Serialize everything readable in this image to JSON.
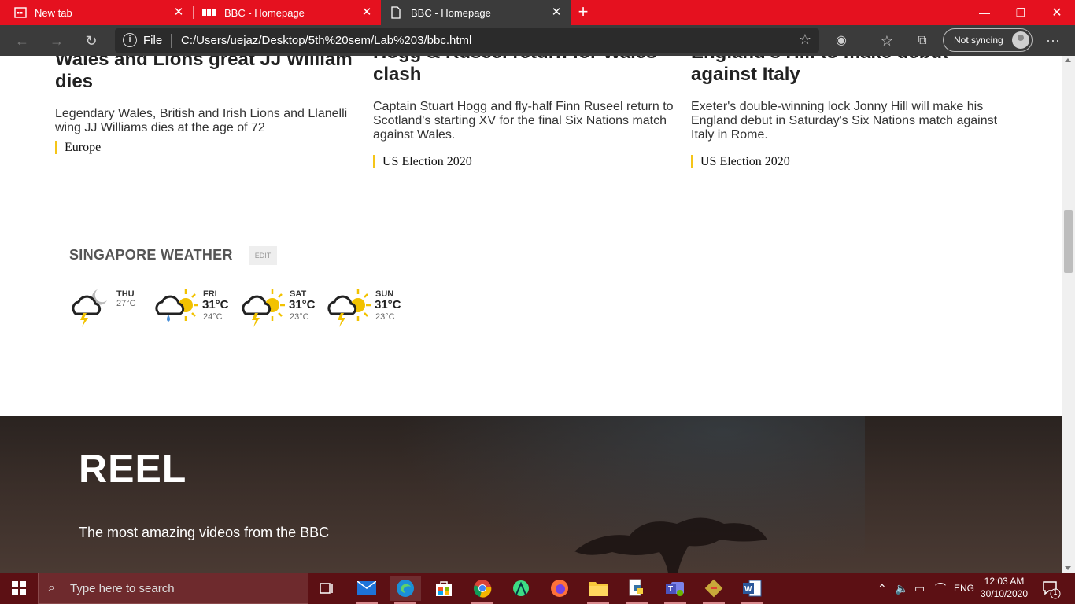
{
  "browser": {
    "tabs": [
      {
        "title": "New tab",
        "icon": "newtab-icon"
      },
      {
        "title": "BBC - Homepage",
        "icon": "bbc-icon"
      },
      {
        "title": "BBC - Homepage",
        "icon": "page-icon"
      }
    ],
    "address": {
      "scheme_label": "File",
      "url": "C:/Users/uejaz/Desktop/5th%20sem/Lab%203/bbc.html"
    },
    "profile_label": "Not syncing",
    "accent_color": "#e5111f"
  },
  "stories": [
    {
      "title": "Wales and Lions great JJ William dies",
      "summary": "Legendary Wales, British and Irish Lions and Llanelli wing JJ Williams dies at the age of 72",
      "tag": "Europe"
    },
    {
      "title": "Hogg & Ruseel return for Wales clash",
      "summary": "Captain Stuart Hogg and fly-half Finn Ruseel return to Scotland's starting XV for the final Six Nations match against Wales.",
      "tag": "US Election 2020"
    },
    {
      "title": "England's Hill to make debut against Italy",
      "summary": "Exeter's double-winning lock Jonny Hill will make his England debut in Saturday's Six Nations match against Italy in Rome.",
      "tag": "US Election 2020"
    }
  ],
  "weather": {
    "title": "SINGAPORE WEATHER",
    "edit_label": "EDIT",
    "days": [
      {
        "day": "THU",
        "high": "",
        "low": "27°C",
        "icon": "thunder-night-icon"
      },
      {
        "day": "FRI",
        "high": "31°C",
        "low": "24°C",
        "icon": "sun-rain-icon"
      },
      {
        "day": "SAT",
        "high": "31°C",
        "low": "23°C",
        "icon": "sun-thunder-icon"
      },
      {
        "day": "SUN",
        "high": "31°C",
        "low": "23°C",
        "icon": "sun-thunder-icon"
      }
    ]
  },
  "reel": {
    "title": "REEL",
    "subtitle": "The most amazing videos from the BBC"
  },
  "taskbar": {
    "search_placeholder": "Type here to search",
    "language": "ENG",
    "time": "12:03 AM",
    "date": "30/10/2020",
    "notification_count": "1",
    "apps": [
      "task-view-icon",
      "mail-icon",
      "edge-icon",
      "store-icon",
      "chrome-icon",
      "android-studio-icon",
      "firefox-icon",
      "file-explorer-icon",
      "python-icon",
      "teams-icon",
      "git-icon",
      "word-icon"
    ]
  }
}
